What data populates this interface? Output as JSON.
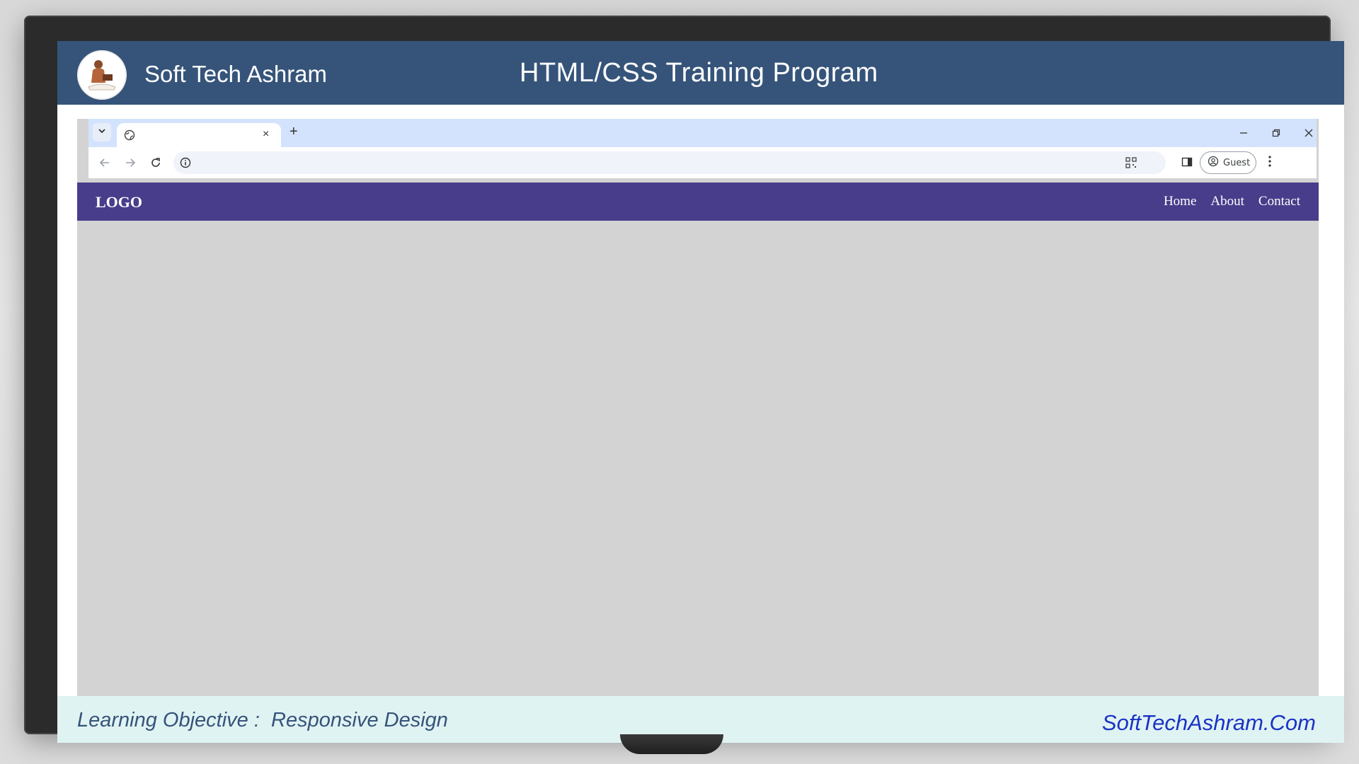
{
  "banner": {
    "brand": "Soft Tech Ashram",
    "title": "HTML/CSS Training Program"
  },
  "browser": {
    "tab_close_glyph": "×",
    "new_tab_glyph": "+",
    "guest_label": "Guest",
    "icons": [
      "chevron-down-icon",
      "globe-icon",
      "close-icon",
      "plus-icon",
      "minimize-icon",
      "restore-icon",
      "window-close-icon",
      "back-icon",
      "forward-icon",
      "reload-icon",
      "info-icon",
      "qr-code-icon",
      "side-panel-icon",
      "profile-icon",
      "more-menu-icon"
    ]
  },
  "site": {
    "logo": "LOGO",
    "nav": [
      "Home",
      "About",
      "Contact"
    ],
    "nav_color": "#483d8b",
    "body_color": "#d3d3d3"
  },
  "footer": {
    "objective_label": "Learning Objective :  ",
    "objective_value": "Responsive Design",
    "site": "SoftTechAshram.Com"
  },
  "colors": {
    "banner": "#36547a",
    "footer_bg": "#e0f3f3",
    "footer_link": "#1a33c4"
  }
}
